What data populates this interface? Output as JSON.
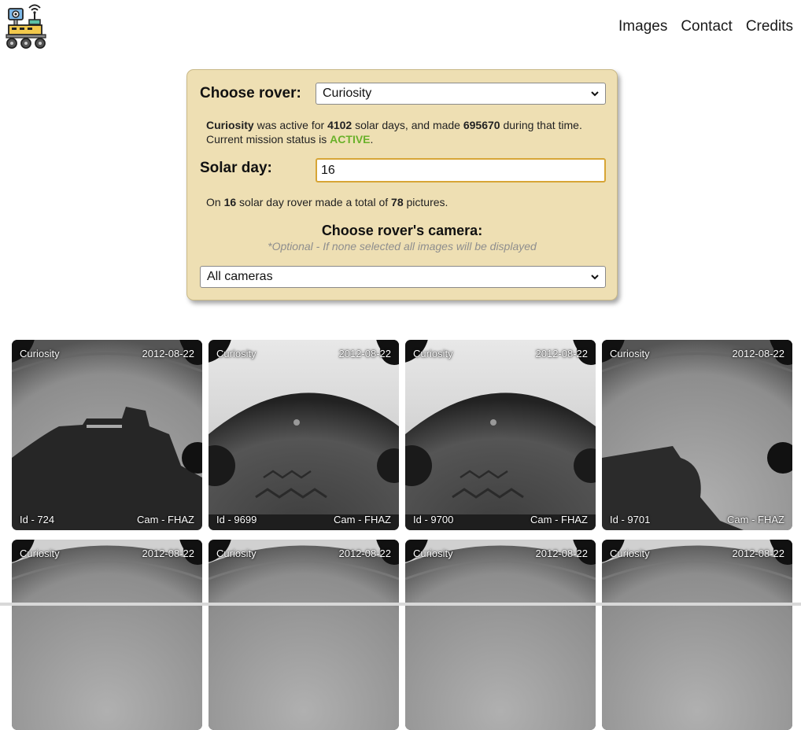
{
  "nav": {
    "items": [
      "Images",
      "Contact",
      "Credits"
    ]
  },
  "form": {
    "rover_label": "Choose rover:",
    "rover_value": "Curiosity",
    "info": {
      "rover": "Curiosity",
      "t1": " was active for ",
      "solar_days": "4102",
      "t2": " solar days, and made ",
      "photos": "695670",
      "t3": " during that time.",
      "status_prefix": "Current mission status is ",
      "status": "ACTIVE",
      "status_suffix": "."
    },
    "sol_label": "Solar day:",
    "sol_value": "16",
    "sol_info": {
      "t1": "On ",
      "sol": "16",
      "t2": " solar day rover made a total of ",
      "count": "78",
      "t3": " pictures."
    },
    "camera_title": "Choose rover's camera:",
    "camera_optional": "*Optional - If none selected all images will be displayed",
    "camera_value": "All cameras"
  },
  "photos": [
    {
      "rover": "Curiosity",
      "date": "2012-08-22",
      "id": "Id - 724",
      "cam": "Cam - FHAZ",
      "style": "shadow"
    },
    {
      "rover": "Curiosity",
      "date": "2012-08-22",
      "id": "Id - 9699",
      "cam": "Cam - FHAZ",
      "style": "tracks"
    },
    {
      "rover": "Curiosity",
      "date": "2012-08-22",
      "id": "Id - 9700",
      "cam": "Cam - FHAZ",
      "style": "tracks"
    },
    {
      "rover": "Curiosity",
      "date": "2012-08-22",
      "id": "Id - 9701",
      "cam": "Cam - FHAZ",
      "style": "shadow2"
    },
    {
      "rover": "Curiosity",
      "date": "2012-08-22",
      "id": "",
      "cam": "",
      "style": "bright"
    },
    {
      "rover": "Curiosity",
      "date": "2012-08-22",
      "id": "",
      "cam": "",
      "style": "bright"
    },
    {
      "rover": "Curiosity",
      "date": "2012-08-22",
      "id": "",
      "cam": "",
      "style": "bright"
    },
    {
      "rover": "Curiosity",
      "date": "2012-08-22",
      "id": "",
      "cam": "",
      "style": "bright"
    }
  ],
  "colors": {
    "panel": "#eedfb3",
    "active": "#6ab12a",
    "input_border": "#d7a536"
  },
  "icons": {
    "logo": "rover-logo-icon",
    "select": "chevron-down-icon"
  }
}
